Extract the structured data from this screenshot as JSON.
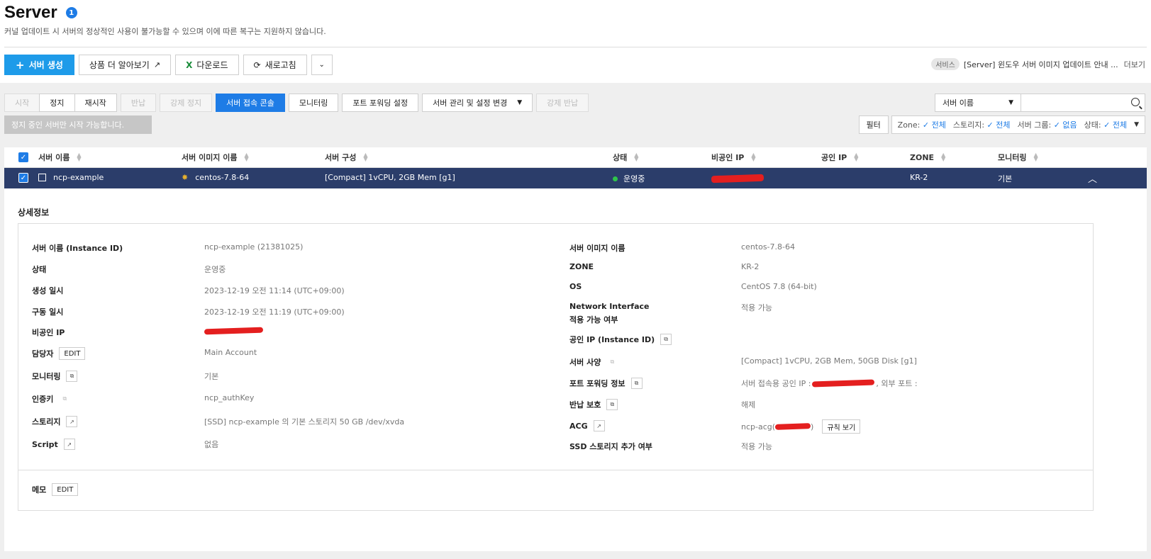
{
  "header": {
    "title": "Server",
    "count": "1",
    "subtitle": "커널 업데이트 시 서버의 정상적인 사용이 불가능할 수 있으며 이에 따른 복구는 지원하지 않습니다."
  },
  "toolbar": {
    "create": "서버 생성",
    "learn_more": "상품 더 알아보기",
    "download": "다운로드",
    "refresh": "새로고침"
  },
  "notice": {
    "tag": "서비스",
    "text": "[Server] 윈도우 서버 이미지 업데이트 안내 ...",
    "more": "더보기"
  },
  "actions": {
    "start": "시작",
    "stop": "정지",
    "restart": "재시작",
    "return": "반납",
    "force_stop": "강제 정지",
    "console": "서버 접속 콘솔",
    "monitoring": "모니터링",
    "port_forwarding": "포트 포워딩 설정",
    "manage": "서버 관리 및 설정 변경",
    "force_return": "강제 반납"
  },
  "tooltip": "정지 중인 서버만 시작 가능합니다.",
  "search": {
    "field": "서버 이름",
    "placeholder": ""
  },
  "filter": {
    "button": "필터",
    "zone_label": "Zone:",
    "zone_value": "전체",
    "storage_label": "스토리지:",
    "storage_value": "전체",
    "group_label": "서버 그룹:",
    "group_value": "없음",
    "status_label": "상태:",
    "status_value": "전체"
  },
  "table": {
    "headers": [
      "서버 이름",
      "서버 이미지 이름",
      "서버 구성",
      "상태",
      "비공인 IP",
      "공인 IP",
      "ZONE",
      "모니터링"
    ],
    "row": {
      "name": "ncp-example",
      "image": "centos-7.8-64",
      "spec": "[Compact] 1vCPU, 2GB Mem [g1]",
      "status": "운영중",
      "zone": "KR-2",
      "monitoring": "기본"
    }
  },
  "detail": {
    "title": "상세정보",
    "left": [
      {
        "label": "서버 이름 (Instance ID)",
        "value": "ncp-example (21381025)"
      },
      {
        "label": "상태",
        "value": "운영중"
      },
      {
        "label": "생성 일시",
        "value": "2023-12-19 오전 11:14 (UTC+09:00)"
      },
      {
        "label": "구동 일시",
        "value": "2023-12-19 오전 11:19 (UTC+09:00)"
      },
      {
        "label": "비공인 IP",
        "value": ""
      },
      {
        "label": "담당자",
        "value": "Main Account"
      },
      {
        "label": "모니터링",
        "value": "기본"
      },
      {
        "label": "인증키",
        "value": "ncp_authKey"
      },
      {
        "label": "스토리지",
        "value": "[SSD] ncp-example 의 기본 스토리지  50 GB /dev/xvda"
      },
      {
        "label": "Script",
        "value": "없음"
      }
    ],
    "right": [
      {
        "label": "서버 이미지 이름",
        "value": "centos-7.8-64"
      },
      {
        "label": "ZONE",
        "value": "KR-2"
      },
      {
        "label": "OS",
        "value": "CentOS 7.8 (64-bit)"
      },
      {
        "label": "Network Interface",
        "label2": "적용 가능 여부",
        "value": "적용 가능"
      },
      {
        "label": "공인 IP (Instance ID)",
        "value": ""
      },
      {
        "label": "서버 사양",
        "value": "[Compact] 1vCPU, 2GB Mem, 50GB Disk [g1]"
      },
      {
        "label": "포트 포워딩 정보",
        "value_a": "서버 접속용 공인 IP :",
        "value_b": ", 외부 포트 :"
      },
      {
        "label": "반납 보호",
        "value": "해제"
      },
      {
        "label": "ACG",
        "value_a": "ncp-acg(",
        "value_b": ")",
        "rules": "규칙 보기"
      },
      {
        "label": "SSD 스토리지 추가 여부",
        "value": "적용 가능"
      }
    ],
    "edit": "EDIT",
    "memo": "메모"
  },
  "colors": {
    "primary": "#1e9be9",
    "console": "#1e7ce6",
    "selected_row": "#2b3d6a",
    "status_dot": "#2ec54a",
    "redaction": "#e41f1f"
  }
}
